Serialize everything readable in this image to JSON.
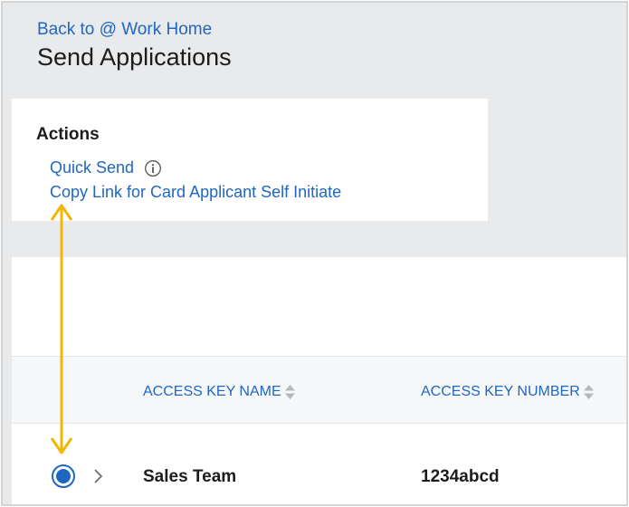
{
  "header": {
    "back_link": "Back to @ Work Home",
    "title": "Send Applications"
  },
  "actions": {
    "heading": "Actions",
    "quick_send": "Quick Send",
    "copy_link": "Copy Link for Card Applicant Self Initiate"
  },
  "table": {
    "columns": [
      "ACCESS KEY NAME",
      "ACCESS KEY NUMBER"
    ],
    "rows": [
      {
        "name": "Sales Team",
        "number": "1234abcd",
        "selected": true
      }
    ]
  },
  "icons": {
    "info": "info-icon",
    "sort": "sort-icon",
    "expand": "chevron-right-icon",
    "annotation": "double-headed-arrow-icon"
  },
  "colors": {
    "link": "#1f67c1",
    "page_background": "#e9eaec",
    "card_background": "#ffffff",
    "annotation": "#f2b705"
  }
}
